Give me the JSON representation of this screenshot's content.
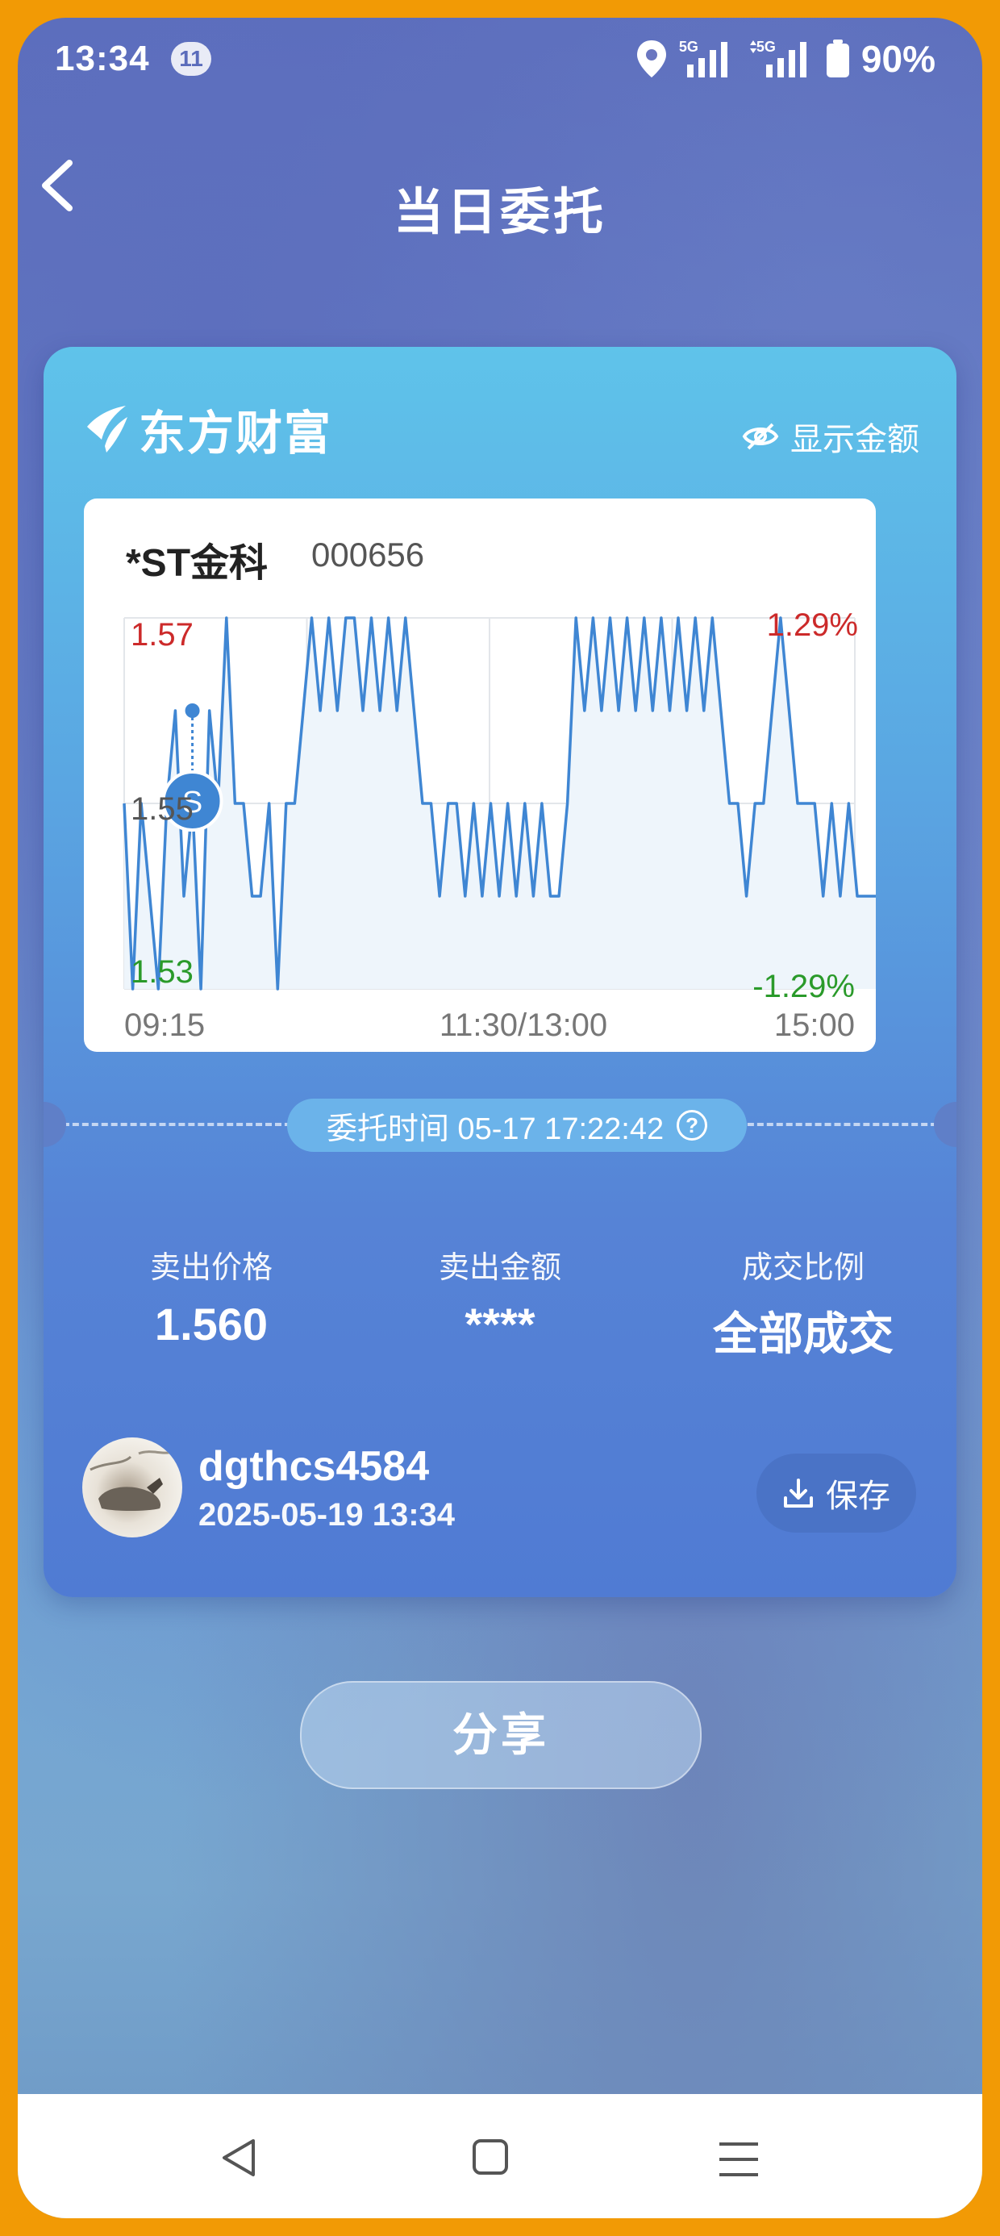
{
  "status_bar": {
    "time": "13:34",
    "notification_count": "11",
    "network_1": "5G",
    "network_2": "5G",
    "battery": "90%"
  },
  "header": {
    "title": "当日委托"
  },
  "card": {
    "brand": "东方财富",
    "show_amount_label": "显示金额",
    "stock": {
      "name": "*ST金科",
      "code": "000656"
    },
    "chart": {
      "price_high": "1.57",
      "price_mid": "1.55",
      "price_low": "1.53",
      "pct_high": "1.29%",
      "pct_low": "-1.29%",
      "x_labels": [
        "09:15",
        "11:30/13:00",
        "15:00"
      ],
      "marker_label": "S"
    },
    "entrust_time": "委托时间 05-17 17:22:42",
    "stats": [
      {
        "label": "卖出价格",
        "value": "1.560"
      },
      {
        "label": "卖出金额",
        "value": "****"
      },
      {
        "label": "成交比例",
        "value": "全部成交"
      }
    ],
    "user": {
      "name": "dgthcs4584",
      "datetime": "2025-05-19 13:34"
    },
    "save_label": "保存"
  },
  "share_label": "分享",
  "chart_data": {
    "type": "line",
    "x_ticks": [
      "09:15",
      "11:30/13:00",
      "15:00"
    ],
    "ylim": [
      1.53,
      1.57
    ],
    "y_ticks": [
      "1.57",
      "1.55",
      "1.53"
    ],
    "pct_ticks": [
      "1.29%",
      "-1.29%"
    ],
    "series": [
      {
        "values": [
          1.55,
          1.53,
          1.55,
          1.54,
          1.53,
          1.55,
          1.56,
          1.54,
          1.55,
          1.53,
          1.56,
          1.55,
          1.57,
          1.55,
          1.55,
          1.54,
          1.54,
          1.55,
          1.53,
          1.55,
          1.55,
          1.56,
          1.57,
          1.56,
          1.57,
          1.56,
          1.57,
          1.57,
          1.56,
          1.57,
          1.56,
          1.57,
          1.56,
          1.57,
          1.56,
          1.55,
          1.55,
          1.54,
          1.55,
          1.55,
          1.54,
          1.55,
          1.54,
          1.55,
          1.54,
          1.55,
          1.54,
          1.55,
          1.54,
          1.55,
          1.54,
          1.54,
          1.55,
          1.57,
          1.56,
          1.57,
          1.56,
          1.57,
          1.56,
          1.57,
          1.56,
          1.57,
          1.56,
          1.57,
          1.56,
          1.57,
          1.56,
          1.57,
          1.56,
          1.57,
          1.56,
          1.55,
          1.55,
          1.54,
          1.55,
          1.55,
          1.56,
          1.57,
          1.56,
          1.55,
          1.55,
          1.55,
          1.54,
          1.55,
          1.54,
          1.55,
          1.54,
          1.54,
          1.54,
          1.54
        ]
      }
    ],
    "markers": [
      {
        "label": "S",
        "value": 1.56
      }
    ]
  }
}
